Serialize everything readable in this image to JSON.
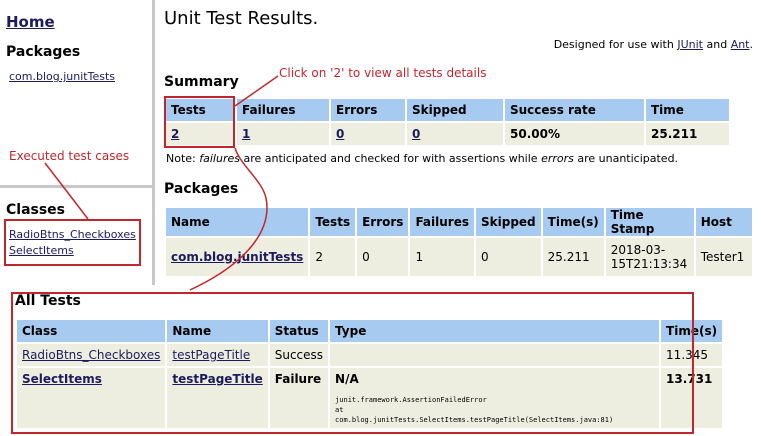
{
  "sidebar": {
    "home": "Home",
    "packages_heading": "Packages",
    "package_link": "com.blog.junitTests",
    "annotation": "Executed test cases",
    "classes_heading": "Classes",
    "classes": [
      "RadioBtns_Checkboxes",
      "SelectItems"
    ]
  },
  "header": {
    "title": "Unit Test Results.",
    "designed_prefix": "Designed for use with ",
    "junit": "JUnit",
    "and": " and ",
    "ant": "Ant",
    "period": "."
  },
  "summary": {
    "heading": "Summary",
    "annotation": "Click on '2' to view all tests details",
    "headers": [
      "Tests",
      "Failures",
      "Errors",
      "Skipped",
      "Success rate",
      "Time"
    ],
    "values": {
      "tests": "2",
      "failures": "1",
      "errors": "0",
      "skipped": "0",
      "success_rate": "50.00%",
      "time": "25.211"
    },
    "note_prefix": "Note: ",
    "note_failures": "failures",
    "note_middle": " are anticipated and checked for with assertions while ",
    "note_errors": "errors",
    "note_suffix": " are unanticipated."
  },
  "packages": {
    "heading": "Packages",
    "headers": [
      "Name",
      "Tests",
      "Errors",
      "Failures",
      "Skipped",
      "Time(s)",
      "Time Stamp",
      "Host"
    ],
    "row": {
      "name": "com.blog.junitTests",
      "tests": "2",
      "errors": "0",
      "failures": "1",
      "skipped": "0",
      "time": "25.211",
      "timestamp_1": "2018-03-",
      "timestamp_2": "15T21:13:34",
      "host": "Tester1"
    }
  },
  "all_tests": {
    "heading": "All Tests",
    "headers": [
      "Class",
      "Name",
      "Status",
      "Type",
      "Time(s)"
    ],
    "rows": [
      {
        "class": "RadioBtns_Checkboxes",
        "name": "testPageTitle",
        "status": "Success",
        "type": "",
        "time": "11.345"
      },
      {
        "class": "SelectItems",
        "name": "testPageTitle",
        "status": "Failure",
        "type": "N/A",
        "time": "13.731",
        "trace_1": "junit.framework.AssertionFailedError",
        "trace_2": "at",
        "trace_3": "com.blog.junitTests.SelectItems.testPageTitle(SelectItems.java:81)"
      }
    ]
  },
  "colors": {
    "header_bg": "#a6caf0",
    "cell_bg": "#eeeee0",
    "annotation_red": "#c0272d",
    "link": "#1b1b5e"
  }
}
